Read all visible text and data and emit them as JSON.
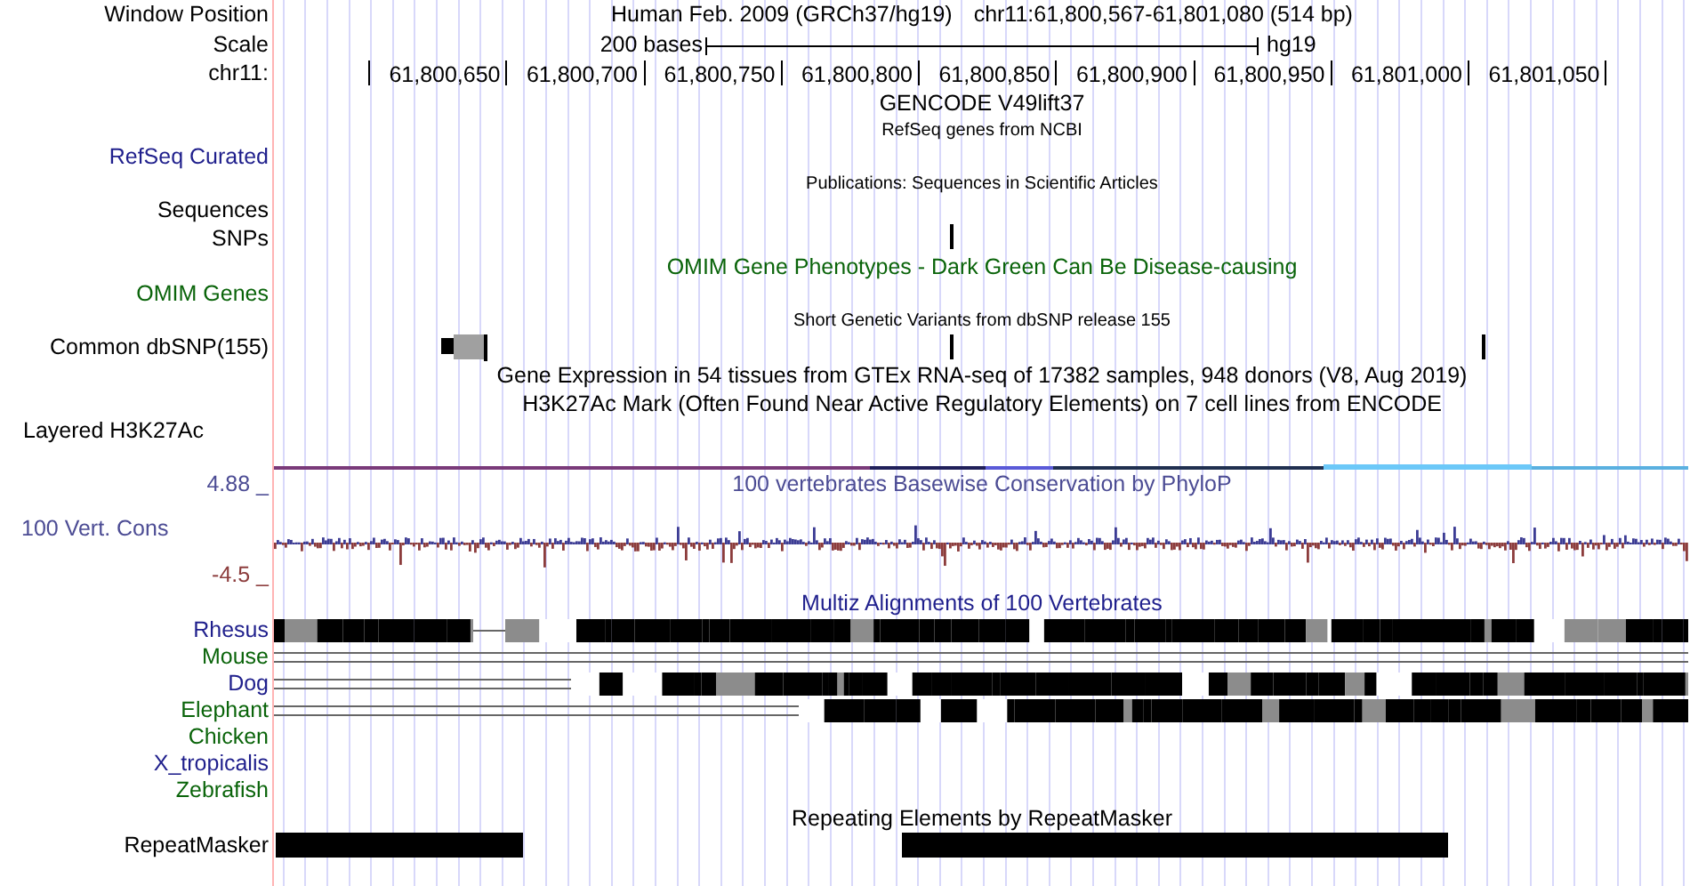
{
  "header": {
    "position_label": "Window Position",
    "scale_label": "Scale",
    "ruler_label": "chr11:",
    "assembly_title": "Human Feb. 2009 (GRCh37/hg19)",
    "position": "chr11:61,800,567-61,801,080 (514 bp)",
    "scale_text": "200 bases",
    "scale_db": "hg19",
    "ticks": [
      "61,800,650",
      "61,800,700",
      "61,800,750",
      "61,800,800",
      "61,800,850",
      "61,800,900",
      "61,800,950",
      "61,801,000",
      "61,801,050"
    ]
  },
  "tracks": [
    {
      "kind": "title",
      "text": "GENCODE V49lift37",
      "color": "#000000",
      "small": false
    },
    {
      "kind": "title",
      "text": "RefSeq genes from NCBI",
      "color": "#000000",
      "small": true
    },
    {
      "kind": "label",
      "label": "RefSeq Curated",
      "color": "#1f1f8c"
    },
    {
      "kind": "title",
      "text": "Publications: Sequences in Scientific Articles",
      "color": "#000000",
      "small": true
    },
    {
      "kind": "label",
      "label": "Sequences",
      "color": "#000000"
    },
    {
      "kind": "snps",
      "label": "SNPs",
      "color": "#000000"
    },
    {
      "kind": "title",
      "text": "OMIM Gene Phenotypes - Dark Green Can Be Disease-causing",
      "color": "#0a640a",
      "small": false
    },
    {
      "kind": "label",
      "label": "OMIM Genes",
      "color": "#0a640a"
    },
    {
      "kind": "title",
      "text": "Short Genetic Variants from dbSNP release 155",
      "color": "#000000",
      "small": true
    },
    {
      "kind": "dbsnp",
      "label": "Common dbSNP(155)",
      "color": "#000000"
    },
    {
      "kind": "title",
      "text": "Gene Expression in 54 tissues from GTEx RNA-seq of 17382 samples, 948 donors (V8, Aug 2019)",
      "color": "#000000",
      "small": false
    },
    {
      "kind": "title",
      "text": "H3K27Ac Mark (Often Found Near Active Regulatory Elements) on 7 cell lines from ENCODE",
      "color": "#000000",
      "small": false
    },
    {
      "kind": "layered",
      "label": "Layered H3K27Ac",
      "color": "#000000"
    },
    {
      "kind": "wiggle",
      "label": "100 Vert. Cons",
      "color": "#4c4c94",
      "title": "100 vertebrates Basewise Conservation by PhyloP",
      "max": "4.88 _",
      "min": "-4.5 _"
    },
    {
      "kind": "title",
      "text": "Multiz Alignments of 100 Vertebrates",
      "color": "#1f1f8c",
      "small": false
    },
    {
      "kind": "species",
      "label": "Rhesus",
      "color": "#1f1f8c"
    },
    {
      "kind": "species",
      "label": "Mouse",
      "color": "#0a640a"
    },
    {
      "kind": "species",
      "label": "Dog",
      "color": "#1f1f8c"
    },
    {
      "kind": "species",
      "label": "Elephant",
      "color": "#0a640a"
    },
    {
      "kind": "species",
      "label": "Chicken",
      "color": "#0a640a"
    },
    {
      "kind": "species",
      "label": "X_tropicalis",
      "color": "#1f1f8c"
    },
    {
      "kind": "species",
      "label": "Zebrafish",
      "color": "#0a640a"
    },
    {
      "kind": "title",
      "text": "Repeating Elements by RepeatMasker",
      "color": "#000000",
      "small": false
    },
    {
      "kind": "repeat",
      "label": "RepeatMasker",
      "color": "#000000"
    }
  ]
}
